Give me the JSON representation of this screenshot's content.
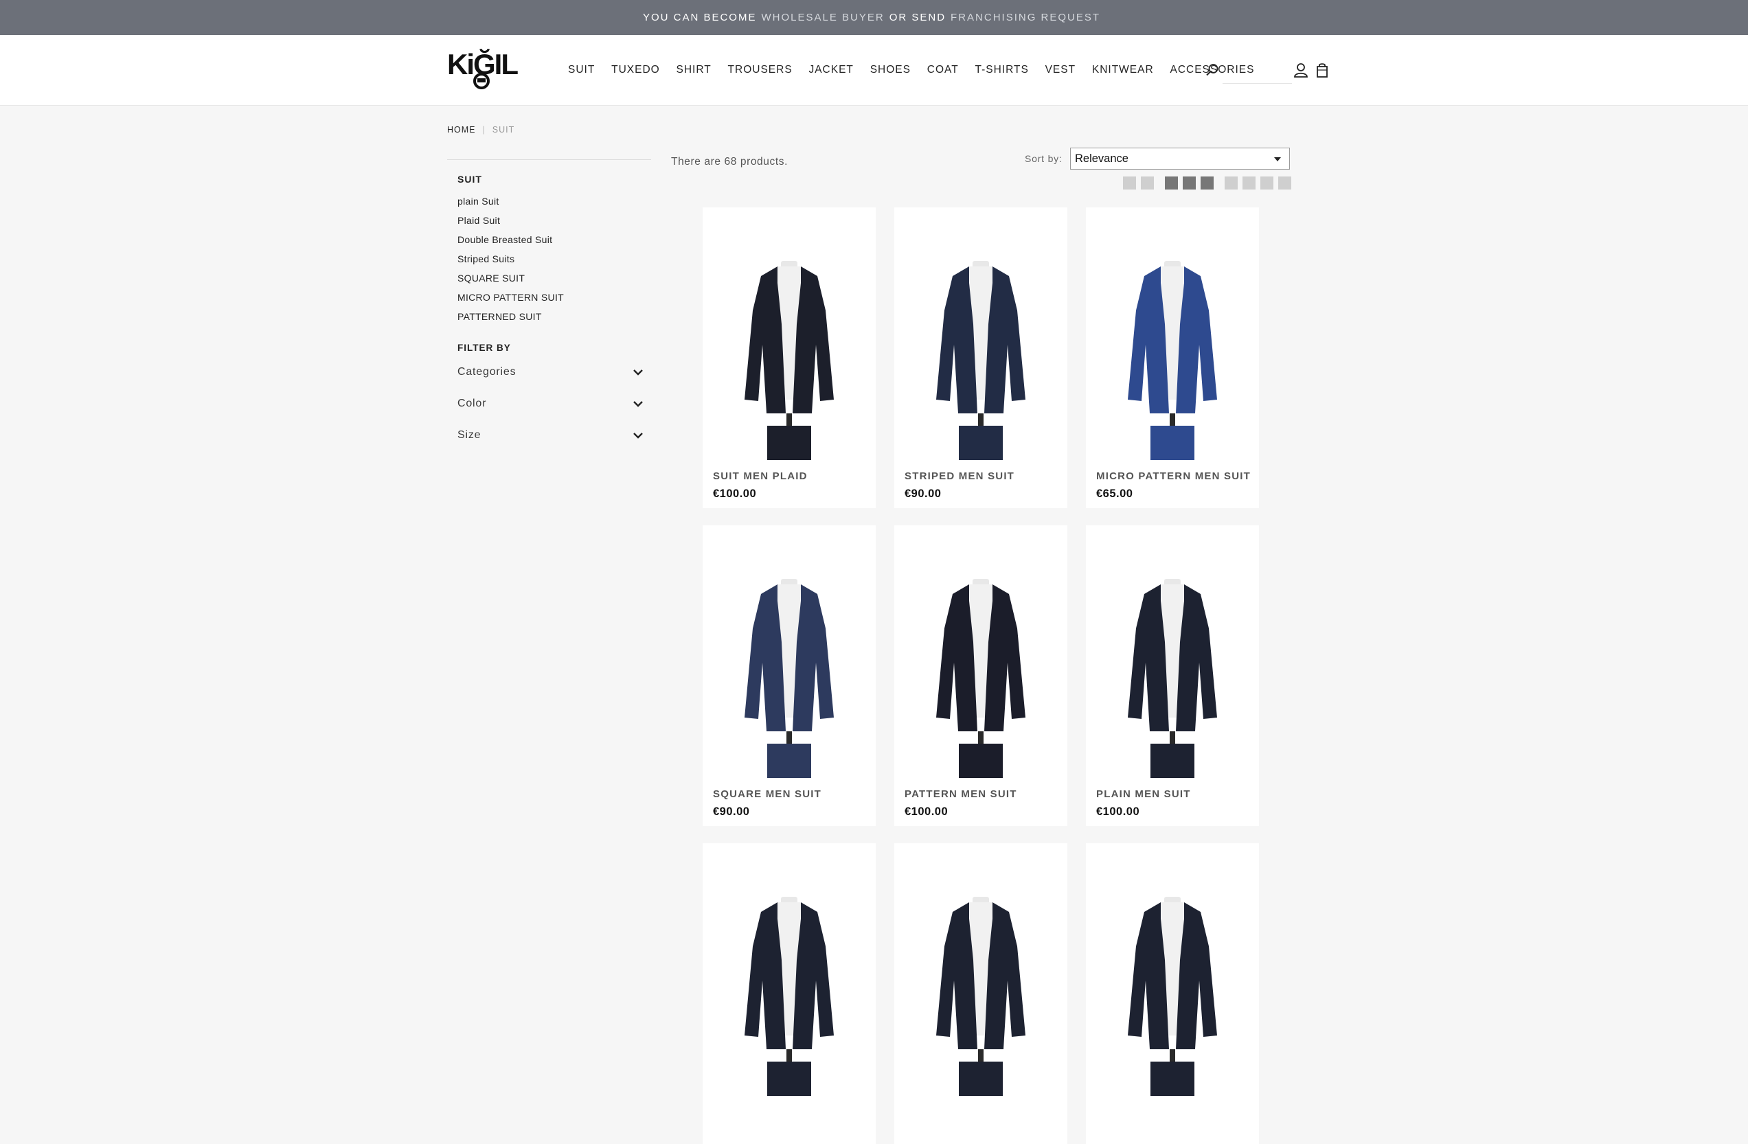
{
  "topbar": {
    "part1": "YOU CAN BECOME",
    "link1": "WHOLESALE BUYER",
    "part2": "OR SEND",
    "link2": "FRANCHISING REQUEST"
  },
  "header": {
    "logo_text": "KiĞILi",
    "nav": [
      "SUIT",
      "TUXEDO",
      "SHIRT",
      "TROUSERS",
      "JACKET",
      "SHOES",
      "COAT",
      "T-SHIRTS",
      "VEST",
      "KNITWEAR",
      "ACCESSORIES"
    ],
    "search_value": ""
  },
  "breadcrumb": {
    "home": "HOME",
    "current": "SUIT"
  },
  "sidebar": {
    "category_title": "SUIT",
    "subcategories": [
      "plain Suit",
      "Plaid Suit",
      "Double Breasted Suit",
      "Striped Suits",
      "SQUARE SUIT",
      "MICRO PATTERN SUIT",
      "PATTERNED SUIT"
    ],
    "filter_title": "FILTER BY",
    "facets": [
      "Categories",
      "Color",
      "Size"
    ]
  },
  "listing": {
    "count_text": "There are 68 products.",
    "sort_label": "Sort by:",
    "sort_value": "Relevance"
  },
  "products": [
    {
      "name": "SUIT MEN PLAID",
      "price": "€100.00",
      "color": "#1c1f2b"
    },
    {
      "name": "STRIPED MEN SUIT",
      "price": "€90.00",
      "color": "#222c45"
    },
    {
      "name": "MICRO PATTERN MEN SUIT",
      "price": "€65.00",
      "color": "#2e4a8f"
    },
    {
      "name": "SQUARE MEN SUIT",
      "price": "€90.00",
      "color": "#2d3a5e"
    },
    {
      "name": "PATTERN MEN SUIT",
      "price": "€100.00",
      "color": "#1b1d2a"
    },
    {
      "name": "PLAIN MEN SUIT",
      "price": "€100.00",
      "color": "#1d2231"
    },
    {
      "name": "",
      "price": "",
      "color": "#1d2231"
    },
    {
      "name": "",
      "price": "",
      "color": "#1d2231"
    },
    {
      "name": "",
      "price": "",
      "color": "#1d2231"
    }
  ]
}
